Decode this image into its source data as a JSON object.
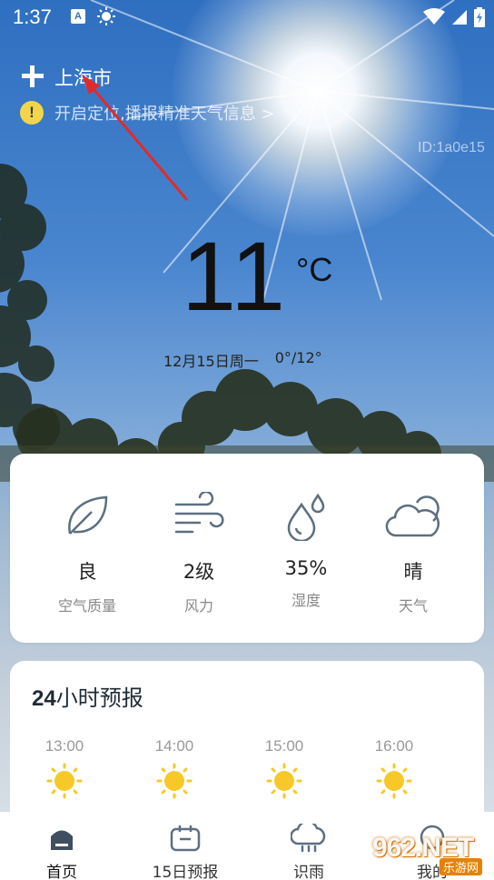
{
  "status_bar": {
    "time": "1:37",
    "a_badge": "A"
  },
  "header": {
    "city": "上海市",
    "notice": "开启定位,播报精准天气信息 >",
    "device_id": "ID:1a0e15"
  },
  "current": {
    "temperature": "11",
    "unit": "°C",
    "date": "12月15日周一",
    "range": "0°/12°"
  },
  "stats": [
    {
      "icon": "leaf-icon",
      "value": "良",
      "label": "空气质量"
    },
    {
      "icon": "wind-icon",
      "value": "2级",
      "label": "风力"
    },
    {
      "icon": "droplets-icon",
      "value": "35%",
      "label": "湿度"
    },
    {
      "icon": "cloud-sun-icon",
      "value": "晴",
      "label": "天气"
    }
  ],
  "hourly": {
    "title_num": "24",
    "title_text": "小时预报",
    "items": [
      {
        "time": "13:00",
        "icon": "sun-icon"
      },
      {
        "time": "14:00",
        "icon": "sun-icon"
      },
      {
        "time": "15:00",
        "icon": "sun-icon"
      },
      {
        "time": "16:00",
        "icon": "sun-icon"
      }
    ]
  },
  "nav": [
    {
      "label": "首页",
      "icon": "home-icon",
      "active": true
    },
    {
      "label": "15日预报",
      "icon": "calendar-icon",
      "active": false
    },
    {
      "label": "识雨",
      "icon": "rain-cloud-icon",
      "active": false
    },
    {
      "label": "我的",
      "icon": "user-icon",
      "active": false
    }
  ],
  "watermark": {
    "main": "962.NET",
    "sub": "乐游网"
  },
  "colors": {
    "sun_yellow": "#f6c928",
    "icon_slate": "#5d6f80",
    "arrow_red": "#e02b2b"
  }
}
